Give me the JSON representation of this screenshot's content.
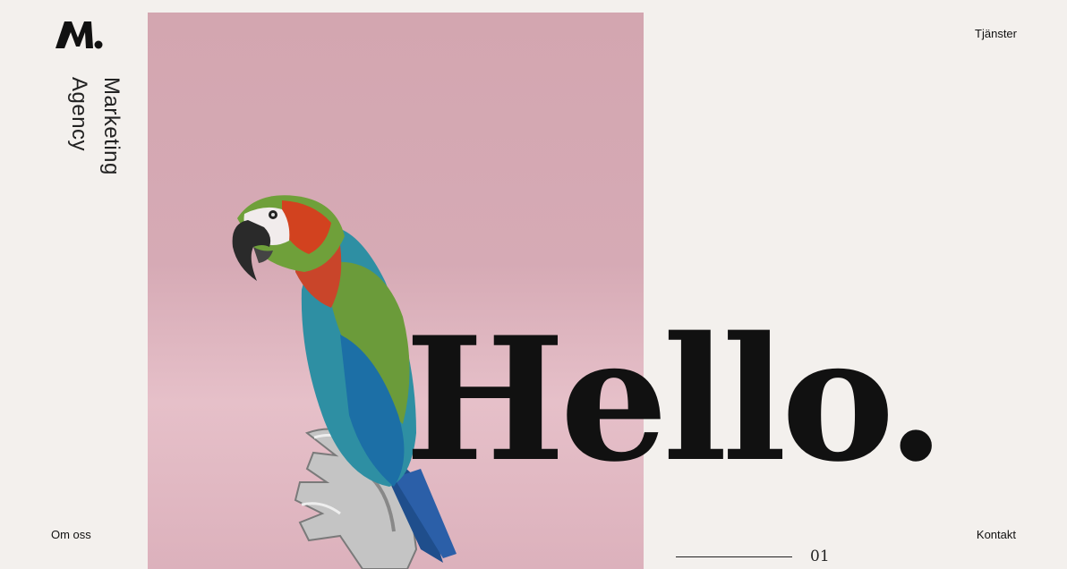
{
  "brand": {
    "logo_text": "M.",
    "tagline_line1": "Marketing",
    "tagline_line2": "Agency"
  },
  "nav": {
    "services": "Tjänster",
    "about": "Om oss",
    "contact": "Kontakt"
  },
  "hero": {
    "headline": "Hello.",
    "slide_number": "01",
    "image_subject": "parrot-on-glove"
  },
  "colors": {
    "background": "#f3f0ed",
    "hero_pink": "#d3a6b0",
    "text": "#111111"
  }
}
